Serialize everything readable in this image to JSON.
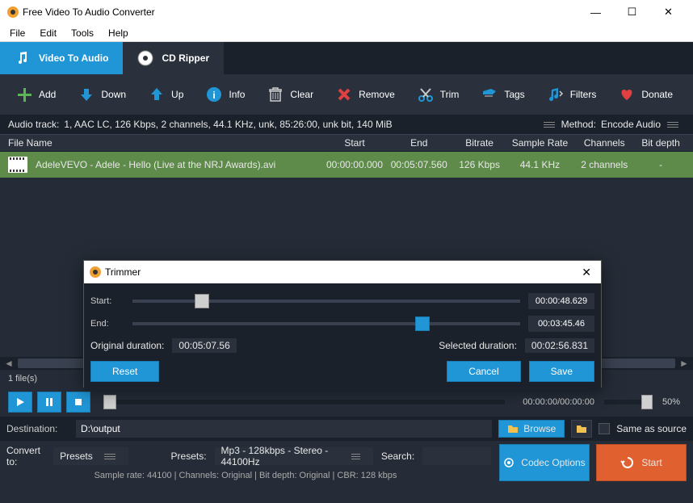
{
  "window": {
    "title": "Free Video To Audio Converter"
  },
  "menu": {
    "file": "File",
    "edit": "Edit",
    "tools": "Tools",
    "help": "Help"
  },
  "tabs": {
    "video_to_audio": "Video To Audio",
    "cd_ripper": "CD Ripper"
  },
  "toolbar": {
    "add": "Add",
    "down": "Down",
    "up": "Up",
    "info": "Info",
    "clear": "Clear",
    "remove": "Remove",
    "trim": "Trim",
    "tags": "Tags",
    "filters": "Filters",
    "donate": "Donate"
  },
  "audio_track": {
    "label": "Audio track:",
    "value": "1, AAC LC, 126 Kbps, 2 channels, 44.1 KHz, unk, 85:26:00, unk bit, 140 MiB",
    "method_label": "Method:",
    "method_value": "Encode Audio"
  },
  "columns": {
    "file": "File Name",
    "start": "Start",
    "end": "End",
    "bitrate": "Bitrate",
    "sample": "Sample Rate",
    "channels": "Channels",
    "bitdepth": "Bit depth"
  },
  "rows": [
    {
      "file": "AdeleVEVO - Adele - Hello (Live at the NRJ Awards).avi",
      "start": "00:00:00.000",
      "end": "00:05:07.560",
      "bitrate": "126 Kbps",
      "sample": "44.1 KHz",
      "channels": "2 channels",
      "bitdepth": "-"
    }
  ],
  "file_count": "1 file(s)",
  "playback": {
    "time": "00:00:00/00:00:00",
    "pct": "50%"
  },
  "destination": {
    "label": "Destination:",
    "value": "D:\\output",
    "browse": "Browse",
    "same_as_source": "Same as source"
  },
  "convert": {
    "label": "Convert to:",
    "presets_label": "Presets",
    "presets2_label": "Presets:",
    "preset_value": "Mp3 - 128kbps - Stereo - 44100Hz",
    "search_label": "Search:",
    "summary": "Sample rate: 44100 | Channels: Original | Bit depth: Original | CBR: 128 kbps",
    "codec_options": "Codec Options",
    "start": "Start"
  },
  "trimmer": {
    "title": "Trimmer",
    "start_label": "Start:",
    "end_label": "End:",
    "start_time": "00:00:48.629",
    "end_time": "00:03:45.46",
    "orig_label": "Original duration:",
    "orig_val": "00:05:07.56",
    "sel_label": "Selected duration:",
    "sel_val": "00:02:56.831",
    "reset": "Reset",
    "cancel": "Cancel",
    "save": "Save"
  }
}
